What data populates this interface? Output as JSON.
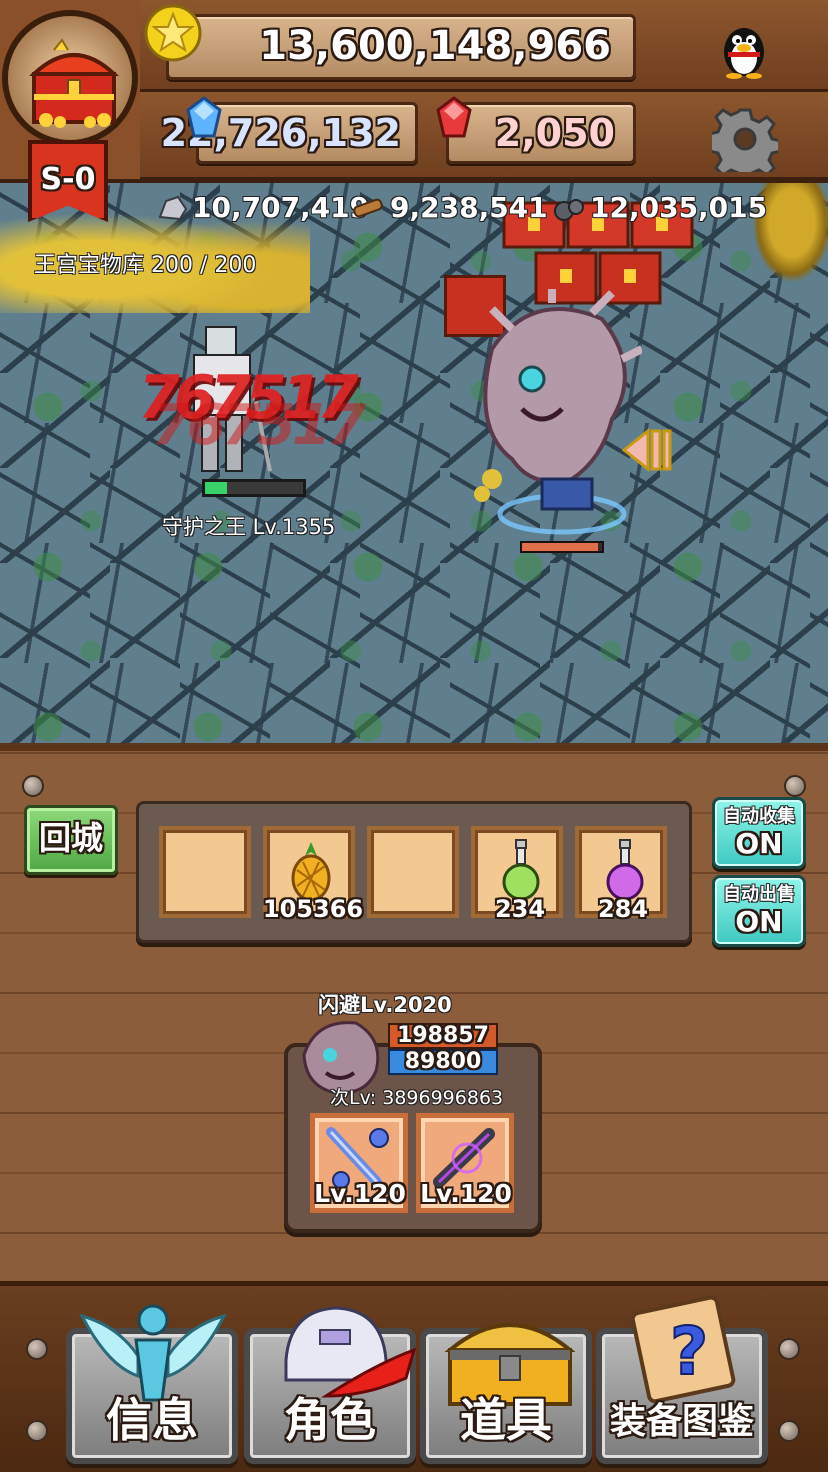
{
  "hud": {
    "gold": "13,600,148,966",
    "blue_gem": "22,726,132",
    "red_gem": "2,050",
    "stage_badge": "S-0",
    "ore_silver": "10,707,419",
    "ore_wood": "9,238,541",
    "ore_iron": "12,035,015",
    "treasury_label": "王宫宝物库 200 / 200",
    "icons": {
      "gold": "gold-star-coin-icon",
      "blue_gem": "blue-crystal-icon",
      "red_gem": "red-crystal-icon",
      "qq": "penguin-icon",
      "settings": "gear-icon",
      "treasure": "treasure-chest-icon"
    }
  },
  "battle": {
    "damage_text": "767517",
    "enemy_name": "守护之王 Lv.1355",
    "enemy_hp_fraction": 0.22,
    "player_hp_fraction": 0.95
  },
  "panel": {
    "town_button": "回城",
    "auto_collect_label": "自动收集",
    "auto_collect_state": "ON",
    "auto_sell_label": "自动出售",
    "auto_sell_state": "ON",
    "slots": [
      {
        "icon": "",
        "count": ""
      },
      {
        "icon": "pineapple-icon",
        "count": "105366"
      },
      {
        "icon": "",
        "count": ""
      },
      {
        "icon": "green-potion-icon",
        "count": "234"
      },
      {
        "icon": "purple-potion-icon",
        "count": "284"
      }
    ],
    "character": {
      "skill_title": "闪避Lv.2020",
      "hp": "198857",
      "mp": "89800",
      "next_level": "次Lv: 3896996863",
      "weapon1_level": "Lv.120",
      "weapon2_level": "Lv.120"
    }
  },
  "nav": {
    "info": "信息",
    "character": "角色",
    "items": "道具",
    "codex": "装备图鉴"
  },
  "colors": {
    "wood": "#7a4f30",
    "green_button": "#4fa844",
    "cyan_button": "#3ec9c2",
    "damage_red": "#e02020"
  }
}
